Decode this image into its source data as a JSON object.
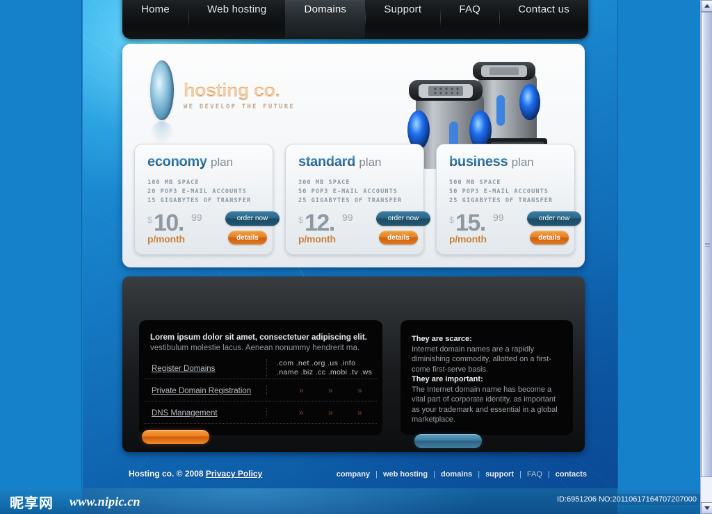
{
  "nav": {
    "items": [
      {
        "label": "Home",
        "active": false
      },
      {
        "label": "Web hosting",
        "active": false
      },
      {
        "label": "Domains",
        "active": true
      },
      {
        "label": "Support",
        "active": false
      },
      {
        "label": "FAQ",
        "active": false
      },
      {
        "label": "Contact us",
        "active": false
      }
    ]
  },
  "logo": {
    "title": "hosting co.",
    "tagline": "WE DEVELOP THE FUTURE"
  },
  "plans": [
    {
      "name": "economy",
      "suffix": "plan",
      "features": [
        "100 MB SPACE",
        "20 POP3 E-MAIL ACCOUNTS",
        "15 GIGABYTES OF TRANSFER"
      ],
      "currency": "$",
      "amount": "10.",
      "cents": "99",
      "period": "p/month",
      "order_label": "order now",
      "details_label": "details"
    },
    {
      "name": "standard",
      "suffix": "plan",
      "features": [
        "300 MB SPACE",
        "50 POP3 E-MAIL ACCOUNTS",
        "25 GIGABYTES OF TRANSFER"
      ],
      "currency": "$",
      "amount": "12.",
      "cents": "99",
      "period": "p/month",
      "order_label": "order now",
      "details_label": "details"
    },
    {
      "name": "business",
      "suffix": "plan",
      "features": [
        "500 MB SPACE",
        "50 POP3 E-MAIL ACCOUNTS",
        "25 GIGABYTES OF TRANSFER"
      ],
      "currency": "$",
      "amount": "15.",
      "cents": "99",
      "period": "p/month",
      "order_label": "order now",
      "details_label": "details"
    }
  ],
  "dark_left": {
    "lead_bold": "Lorem ipsum dolor sit amet, consectetuer adipiscing elit.",
    "lead_rest": " vestibulum molestie lacus. Aenean nonummy hendrerit ma.",
    "rows": [
      {
        "link": "Register Domains",
        "tlds_line1": ".com .net .org .us .info",
        "tlds_line2": ".name .biz .cc .mobi .tv .ws",
        "chevrons": ""
      },
      {
        "link": "Private Domain Registration",
        "tlds_line1": "",
        "tlds_line2": "",
        "chevrons": "» » »"
      },
      {
        "link": "DNS Management",
        "tlds_line1": "",
        "tlds_line2": "",
        "chevrons": "» » »"
      }
    ]
  },
  "dark_right": {
    "heading1": "They are scarce:",
    "body1": "Internet domain names are a rapidly diminishing commodity, allotted on a first-come first-serve basis.",
    "heading2": "They are important:",
    "body2": "The Internet domain name has become a vital part of corporate identity, as important as your trademark and essential in a global marketplace."
  },
  "footer": {
    "copyright": "Hosting co. © 2008 ",
    "privacy_label": "Privacy Policy",
    "links": [
      "company",
      "web hosting",
      "domains",
      "support",
      "FAQ",
      "contacts"
    ],
    "separator": "|"
  },
  "watermark": {
    "logo": "昵享网",
    "url": "www.nipic.cn",
    "id": "ID:6951206 NO:20110617164707207000"
  },
  "colors": {
    "accent_orange": "#e5812a",
    "accent_blue": "#2b6687",
    "page_blue": "#1583cb",
    "dark_panel": "#050505"
  }
}
